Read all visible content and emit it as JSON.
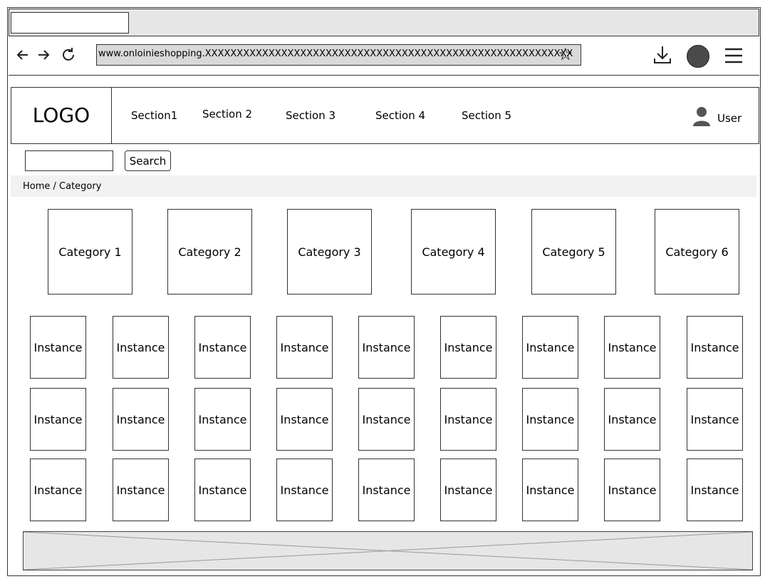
{
  "browser": {
    "url": "www.onloinieshopping.XXXXXXXXXXXXXXXXXXXXXXXXXXXXXXXXXXXXXXXXXXXXXXXXXXXXXXXXXX",
    "icons": [
      "back-arrow-icon",
      "forward-arrow-icon",
      "reload-icon",
      "star-icon",
      "download-icon",
      "profile-circle-icon",
      "hamburger-menu-icon"
    ]
  },
  "header": {
    "logo": "LOGO",
    "sections": [
      "Section1",
      "Section 2",
      "Section 3",
      "Section 4",
      "Section 5"
    ],
    "user_label": "User"
  },
  "search": {
    "button_label": "Search",
    "input_value": ""
  },
  "breadcrumb": "Home / Category",
  "categories": [
    "Category 1",
    "Category 2",
    "Category 3",
    "Category 4",
    "Category 5",
    "Category 6"
  ],
  "instances": {
    "label": "Instance",
    "rows": 3,
    "columns": 9
  },
  "colors": {
    "chrome_gray": "#e6e6e6",
    "url_bar": "#d9d9d9",
    "avatar": "#4a4a4a"
  }
}
